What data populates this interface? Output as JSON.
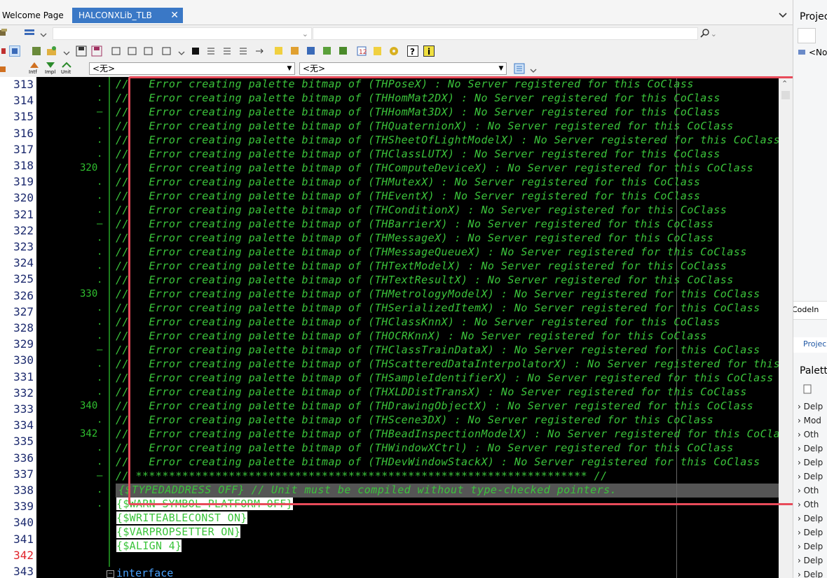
{
  "tabs": {
    "welcome": "Welcome Page",
    "halcon": "HALCONXLib_TLB",
    "close_glyph": "✕"
  },
  "toolbar": {
    "unit_labels": [
      "Intf",
      "Impl",
      "Unit"
    ],
    "class_combo": "<无>",
    "method_combo": "<无>"
  },
  "gutter": {
    "line_numbers": [
      "313",
      "314",
      "315",
      "316",
      "317",
      "318",
      "319",
      "320",
      "321",
      "322",
      "323",
      "324",
      "325",
      "326",
      "327",
      "328",
      "329",
      "330",
      "331",
      "332",
      "333",
      "334",
      "335",
      "336",
      "337",
      "338",
      "339",
      "340",
      "341",
      "342",
      "343"
    ],
    "current_line": "342"
  },
  "editor": {
    "markers": [
      ".",
      ".",
      "–",
      ".",
      ".",
      ".",
      "320",
      ".",
      ".",
      ".",
      "–",
      ".",
      ".",
      ".",
      ".",
      "330",
      ".",
      ".",
      ".",
      "–",
      ".",
      ".",
      ".",
      "340",
      ".",
      "342",
      ".",
      ".",
      "–",
      ".",
      "."
    ],
    "code_lines": [
      "//   Error creating palette bitmap of (THPoseX) : No Server registered for this CoClass",
      "//   Error creating palette bitmap of (THHomMat2DX) : No Server registered for this CoClass",
      "//   Error creating palette bitmap of (THHomMat3DX) : No Server registered for this CoClass",
      "//   Error creating palette bitmap of (THQuaternionX) : No Server registered for this CoClass",
      "//   Error creating palette bitmap of (THSheetOfLightModelX) : No Server registered for this CoClass",
      "//   Error creating palette bitmap of (THClassLUTX) : No Server registered for this CoClass",
      "//   Error creating palette bitmap of (THComputeDeviceX) : No Server registered for this CoClass",
      "//   Error creating palette bitmap of (THMutexX) : No Server registered for this CoClass",
      "//   Error creating palette bitmap of (THEventX) : No Server registered for this CoClass",
      "//   Error creating palette bitmap of (THConditionX) : No Server registered for this CoClass",
      "//   Error creating palette bitmap of (THBarrierX) : No Server registered for this CoClass",
      "//   Error creating palette bitmap of (THMessageX) : No Server registered for this CoClass",
      "//   Error creating palette bitmap of (THMessageQueueX) : No Server registered for this CoClass",
      "//   Error creating palette bitmap of (THTextModelX) : No Server registered for this CoClass",
      "//   Error creating palette bitmap of (THTextResultX) : No Server registered for this CoClass",
      "//   Error creating palette bitmap of (THMetrologyModelX) : No Server registered for this CoClass",
      "//   Error creating palette bitmap of (THSerializedItemX) : No Server registered for this CoClass",
      "//   Error creating palette bitmap of (THClassKnnX) : No Server registered for this CoClass",
      "//   Error creating palette bitmap of (THOCRKnnX) : No Server registered for this CoClass",
      "//   Error creating palette bitmap of (THClassTrainDataX) : No Server registered for this CoClass",
      "//   Error creating palette bitmap of (THScatteredDataInterpolatorX) : No Server registered for this CoClass",
      "//   Error creating palette bitmap of (THSampleIdentifierX) : No Server registered for this CoClass",
      "//   Error creating palette bitmap of (THXLDDistTransX) : No Server registered for this CoClass",
      "//   Error creating palette bitmap of (THDrawingObjectX) : No Server registered for this CoClass",
      "//   Error creating palette bitmap of (THScene3DX) : No Server registered for this CoClass",
      "//   Error creating palette bitmap of (THBeadInspectionModelX) : No Server registered for this CoClass",
      "//   Error creating palette bitmap of (THWindowXCtrl) : No Server registered for this CoClass",
      "//   Error creating palette bitmap of (THDevWindowStackX) : No Server registered for this CoClass",
      "// ******************************************************************** //",
      "{$TYPEDADDRESS OFF} // Unit must be compiled without type-checked pointers."
    ],
    "directives": [
      "{$WARN SYMBOL_PLATFORM OFF}",
      "{$WRITEABLECONST ON}",
      "{$VARPROPSETTER ON}",
      "{$ALIGN 4}"
    ],
    "keyword": "interface",
    "fold_glyph": "−"
  },
  "right_panel": {
    "project_title": "Projec",
    "project_item": "<No",
    "codeinsight_tab": "CodeIn",
    "project_tab": "Projec",
    "palette_title": "Palette",
    "tree_items": [
      "Delp",
      "Mod",
      "Oth",
      "Delp",
      "Delp",
      "Delp",
      "Oth",
      "Oth",
      "Delp",
      "Delp",
      "Delp",
      "Delp",
      "Delp"
    ]
  },
  "colors": {
    "editor_bg": "#000000",
    "comment": "#3bc43b",
    "keyword": "#4aa3ff",
    "line_number": "#1c2a6e",
    "current_line_number": "#e0232a",
    "tab_active_bg": "#3a78c6",
    "annotation_box": "#e84b5a"
  }
}
